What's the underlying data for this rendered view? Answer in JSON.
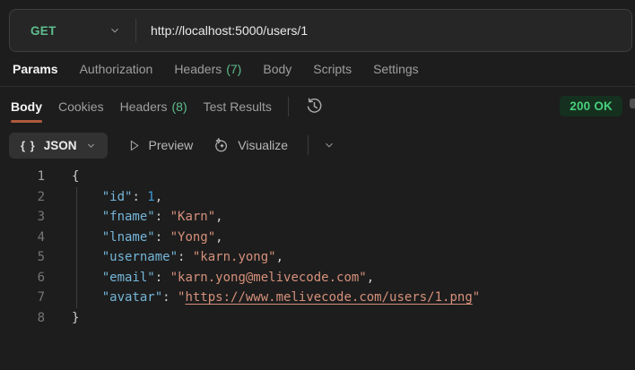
{
  "request": {
    "method": "GET",
    "url": "http://localhost:5000/users/1"
  },
  "request_tabs": [
    {
      "label": "Params"
    },
    {
      "label": "Authorization"
    },
    {
      "label": "Headers",
      "count": "(7)"
    },
    {
      "label": "Body"
    },
    {
      "label": "Scripts"
    },
    {
      "label": "Settings"
    }
  ],
  "response_tabs": [
    {
      "label": "Body"
    },
    {
      "label": "Cookies"
    },
    {
      "label": "Headers",
      "count": "(8)"
    },
    {
      "label": "Test Results"
    }
  ],
  "response_meta": {
    "status": "200 OK"
  },
  "toolbar": {
    "format_glyph": "{ }",
    "format_label": "JSON",
    "preview_label": "Preview",
    "visualize_label": "Visualize"
  },
  "colors": {
    "method_green": "#5ebe8e",
    "status_text": "#47cf7c",
    "status_bg": "#15301f",
    "active_tab_underline": "#b05a3f",
    "json_key": "#74b6d9",
    "json_string": "#d6907b",
    "json_number": "#3f9bd8"
  },
  "code": {
    "lines": [
      [
        {
          "t": "{",
          "c": "p"
        }
      ],
      [
        {
          "t": "    ",
          "c": "p"
        },
        {
          "t": "\"id\"",
          "c": "k"
        },
        {
          "t": ": ",
          "c": "p"
        },
        {
          "t": "1",
          "c": "n"
        },
        {
          "t": ",",
          "c": "p"
        }
      ],
      [
        {
          "t": "    ",
          "c": "p"
        },
        {
          "t": "\"fname\"",
          "c": "k"
        },
        {
          "t": ": ",
          "c": "p"
        },
        {
          "t": "\"Karn\"",
          "c": "s"
        },
        {
          "t": ",",
          "c": "p"
        }
      ],
      [
        {
          "t": "    ",
          "c": "p"
        },
        {
          "t": "\"lname\"",
          "c": "k"
        },
        {
          "t": ": ",
          "c": "p"
        },
        {
          "t": "\"Yong\"",
          "c": "s"
        },
        {
          "t": ",",
          "c": "p"
        }
      ],
      [
        {
          "t": "    ",
          "c": "p"
        },
        {
          "t": "\"username\"",
          "c": "k"
        },
        {
          "t": ": ",
          "c": "p"
        },
        {
          "t": "\"karn.yong\"",
          "c": "s"
        },
        {
          "t": ",",
          "c": "p"
        }
      ],
      [
        {
          "t": "    ",
          "c": "p"
        },
        {
          "t": "\"email\"",
          "c": "k"
        },
        {
          "t": ": ",
          "c": "p"
        },
        {
          "t": "\"karn.yong@melivecode.com\"",
          "c": "s"
        },
        {
          "t": ",",
          "c": "p"
        }
      ],
      [
        {
          "t": "    ",
          "c": "p"
        },
        {
          "t": "\"avatar\"",
          "c": "k"
        },
        {
          "t": ": ",
          "c": "p"
        },
        {
          "t": "\"",
          "c": "s"
        },
        {
          "t": "https://www.melivecode.com/users/1.png",
          "c": "su"
        },
        {
          "t": "\"",
          "c": "s"
        }
      ],
      [
        {
          "t": "}",
          "c": "p"
        }
      ]
    ]
  }
}
